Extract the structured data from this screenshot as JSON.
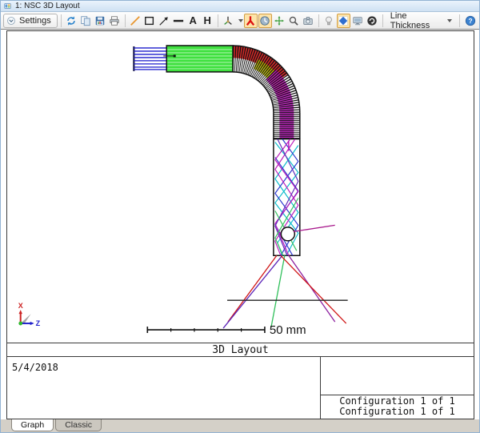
{
  "window": {
    "title": "1: NSC 3D Layout"
  },
  "toolbar": {
    "settings_label": "Settings",
    "tool_a": "A",
    "tool_h": "H",
    "line_thickness_label": "Line Thickness",
    "help_glyph": "?",
    "icons": [
      "settings-chevron-icon",
      "refresh-icon",
      "copy-icon",
      "save-icon",
      "print-icon",
      "draw-line-icon",
      "draw-rectangle-icon",
      "draw-arrow-icon",
      "draw-thick-line-icon",
      "text-a-tool",
      "text-h-tool",
      "axis-orientation-icon",
      "fly-through-icon",
      "real-time-icon",
      "pan-icon",
      "zoom-icon",
      "camera-icon",
      "lightbulb-icon",
      "solid-model-icon",
      "monitor-icon",
      "reset-view-icon",
      "help-icon"
    ]
  },
  "viewport": {
    "scale_label": "50 mm",
    "axis_x_label": "X",
    "axis_z_label": "Z"
  },
  "footer": {
    "title": "3D Layout",
    "date": "5/4/2018",
    "config_line1": "Configuration 1 of 1",
    "config_line2": "Configuration 1 of 1"
  },
  "tabs": [
    {
      "label": "Graph",
      "active": true
    },
    {
      "label": "Classic",
      "active": false
    }
  ],
  "colors": {
    "ray_blue": "#2330cc",
    "ray_red": "#d01616",
    "ray_magenta": "#b911b9",
    "ray_cyan": "#00b9c9",
    "ray_green": "#2fbf5a",
    "ray_violet": "#5b23b8",
    "ray_purple": "#8d1f9f",
    "ray_yellow": "#b8b800",
    "pipe_green_fill": "#3fe03f",
    "toolbar_highlight": "#fde4a9",
    "titlebar_blue": "#d9e7f5"
  }
}
